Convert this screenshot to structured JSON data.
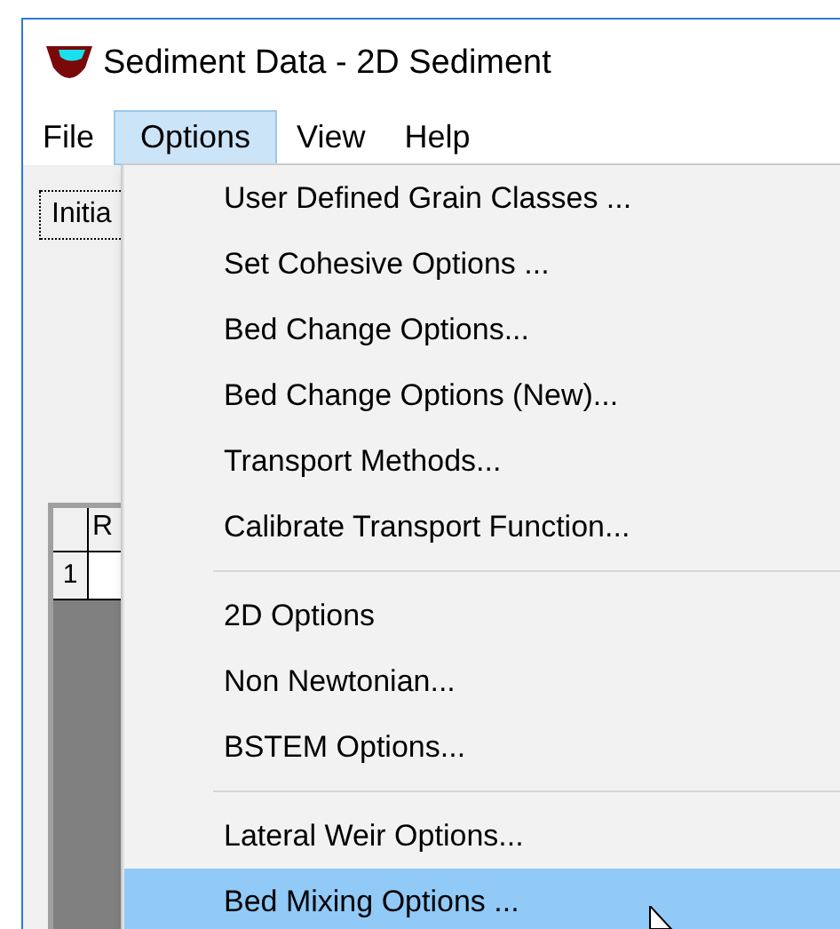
{
  "window": {
    "title": "Sediment Data - 2D Sediment"
  },
  "menu_bar": [
    {
      "label": "File",
      "selected": false
    },
    {
      "label": "Options",
      "selected": true
    },
    {
      "label": "View",
      "selected": false
    },
    {
      "label": "Help",
      "selected": false
    }
  ],
  "tab_button": {
    "label": "Initia"
  },
  "grid": {
    "column_1": "R",
    "row_1": "1"
  },
  "options_menu": [
    {
      "kind": "item",
      "label": "User Defined Grain Classes ...",
      "selected": false
    },
    {
      "kind": "item",
      "label": "Set Cohesive Options ...",
      "selected": false
    },
    {
      "kind": "item",
      "label": "Bed Change Options...",
      "selected": false
    },
    {
      "kind": "item",
      "label": "Bed Change Options (New)...",
      "selected": false
    },
    {
      "kind": "item",
      "label": "Transport Methods...",
      "selected": false
    },
    {
      "kind": "item",
      "label": "Calibrate Transport Function...",
      "selected": false
    },
    {
      "kind": "separator"
    },
    {
      "kind": "item",
      "label": "2D Options",
      "selected": false
    },
    {
      "kind": "item",
      "label": "Non Newtonian...",
      "selected": false
    },
    {
      "kind": "item",
      "label": "BSTEM Options...",
      "selected": false
    },
    {
      "kind": "separator"
    },
    {
      "kind": "item",
      "label": "Lateral Weir Options...",
      "selected": false
    },
    {
      "kind": "item",
      "label": "Bed Mixing Options ...",
      "selected": true
    }
  ]
}
